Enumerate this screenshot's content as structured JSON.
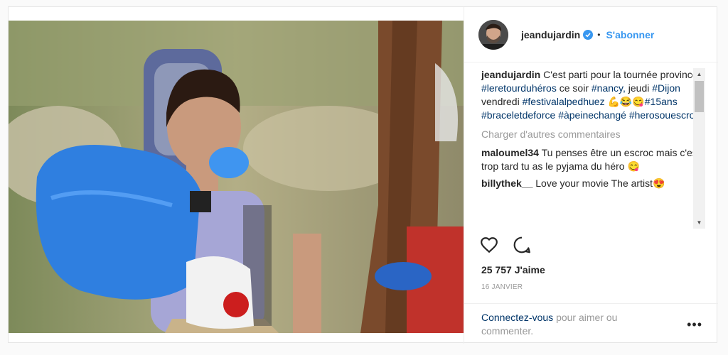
{
  "post": {
    "username": "jeandujardin",
    "verified": true,
    "dot": "•",
    "follow_label": "S'abonner",
    "photo_alt": "",
    "caption": {
      "username": "jeandujardin",
      "text1": "C'est parti pour la tournée province",
      "tag1": "#leretourduhéros",
      "text2": "ce soir",
      "tag2": "#nancy,",
      "text3": "jeudi",
      "tag3": "#Dijon",
      "text4": "vendredi",
      "tag4": "#festivalalpedhuez",
      "emojis": "💪😂😋",
      "tag5": "#15ans",
      "tag6": "#braceletdeforce",
      "tag7": "#àpeinechangé",
      "tag8": "#herosouescroc"
    },
    "load_more": "Charger d'autres commentaires",
    "comments": [
      {
        "username": "maloumel34",
        "text": "Tu penses être un escroc mais c'est trop tard tu as le pyjama du héro 😋"
      },
      {
        "username": "billythek__",
        "text": "Love your movie The artist😍"
      }
    ],
    "likes": "25 757 J'aime",
    "date": "16 JANVIER",
    "login_link": "Connectez-vous",
    "login_text": "pour aimer ou commenter.",
    "more_options": "•••",
    "icons": [
      "heart-icon",
      "comment-icon",
      "verified-badge-icon",
      "more-options-icon"
    ],
    "colors": {
      "link": "#3897f0",
      "hashtag": "#003569",
      "muted": "#999999",
      "text": "#262626"
    }
  }
}
